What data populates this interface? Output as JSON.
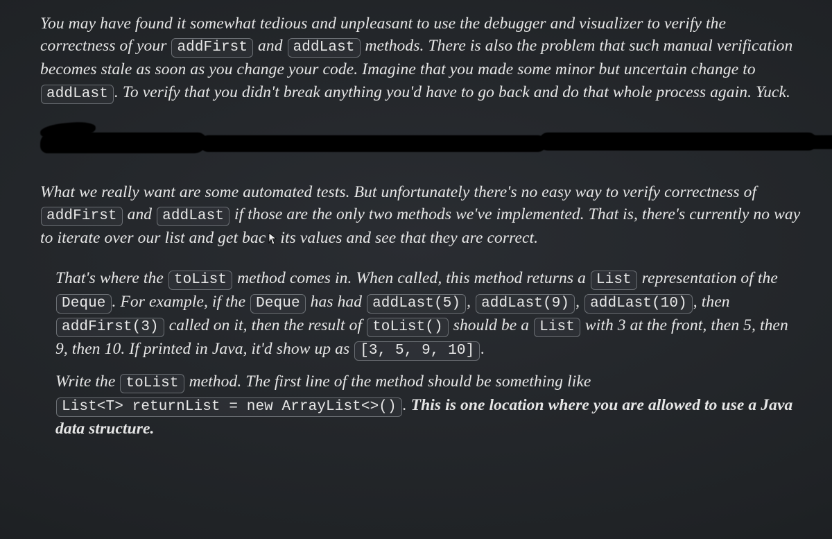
{
  "paragraphs": {
    "p1": {
      "s1": "You may have found it somewhat tedious and unpleasant to use the debugger and visualizer to verify the correctness of your ",
      "c1": "addFirst",
      "s2": " and ",
      "c2": "addLast",
      "s3": " methods. There is also the problem that such manual verification becomes stale as soon as you change your code. Imagine that you made some minor but uncertain change to ",
      "c3": "addLast",
      "s4": ". To verify that you didn't break anything you'd have to go back and do that whole process again. Yuck."
    },
    "p2": {
      "s1": "What we really want are some automated tests. But unfortunately there's no easy way to verify correctness of ",
      "c1": "addFirst",
      "s2": " and ",
      "c2": "addLast",
      "s3": " if those are the only two methods we've implemented. That is, there's currently no way to iterate over our list and get bac",
      "cursor": "↖",
      "s4": "its values and see that they are correct."
    },
    "p3": {
      "s1": "That's where the ",
      "c1": "toList",
      "s2": " method comes in. When called, this method returns a ",
      "c2": "List",
      "s3": " representation of the ",
      "c3": "Deque",
      "s4": ". For example, if the ",
      "c4": "Deque",
      "s5": " has had ",
      "c5": "addLast(5)",
      "s6": ", ",
      "c6": "addLast(9)",
      "s7": ", ",
      "c7": "addLast(10)",
      "s8": ", then ",
      "c8": "addFirst(3)",
      "s9": " called on it, then the result of ",
      "c9": "toList()",
      "s10": " should be a ",
      "c10": "List",
      "s11": " with 3 at the front, then 5, then 9, then 10. If printed in Java, it'd show up as ",
      "c11": "[3, 5, 9, 10]",
      "s12": "."
    },
    "p4": {
      "s1": "Write the ",
      "c1": "toList",
      "s2": " method. The first line of the method should be something like ",
      "c2": "List<T> returnList = new ArrayList<>()",
      "s3": ". ",
      "bold": "This is one location where you are allowed to use a Java data structure."
    }
  }
}
